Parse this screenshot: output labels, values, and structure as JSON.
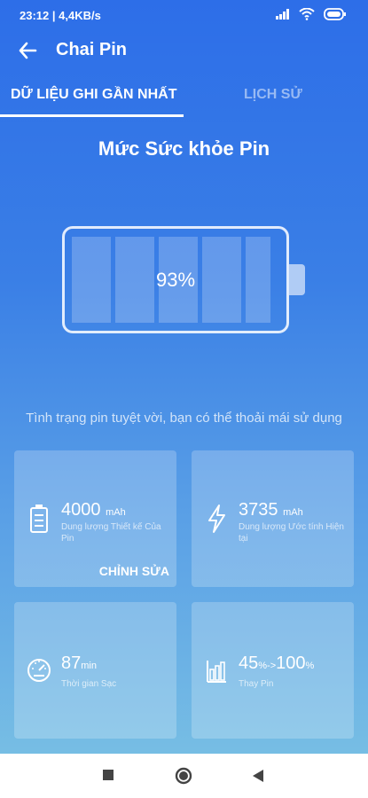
{
  "status": {
    "time": "23:12",
    "speed": "4,4KB/s"
  },
  "header": {
    "title": "Chai Pin"
  },
  "tabs": [
    {
      "label": "DỮ LIỆU GHI GẦN NHẤT",
      "active": true
    },
    {
      "label": "LỊCH SỬ",
      "active": false
    }
  ],
  "health": {
    "heading": "Mức Sức khỏe Pin",
    "percent": "93%",
    "message": "Tình trạng pin tuyệt vời, bạn có thể thoải mái sử dụng"
  },
  "cards": {
    "design": {
      "value": "4000",
      "unit": "mAh",
      "label": "Dung lượng Thiết kế Của Pin",
      "action": "CHỈNH SỬA"
    },
    "estimated": {
      "value": "3735",
      "unit": "mAh",
      "label": "Dung lượng Ước tính Hiện tại"
    },
    "charge_time": {
      "value": "87",
      "unit": "min",
      "label": "Thời gian Sạc"
    },
    "replace": {
      "from": "45",
      "from_unit": "%",
      "arrow": "->",
      "to": "100",
      "to_unit": "%",
      "label": "Thay Pin"
    }
  },
  "colors": {
    "accent": "#2d6ee8",
    "text": "#ffffff"
  },
  "icons": [
    "back-arrow-icon",
    "battery-icon",
    "lightning-icon",
    "speedometer-icon",
    "bar-chart-icon",
    "square-nav-icon",
    "circle-nav-icon",
    "triangle-back-nav-icon",
    "signal-icon",
    "wifi-icon",
    "battery-status-icon"
  ]
}
